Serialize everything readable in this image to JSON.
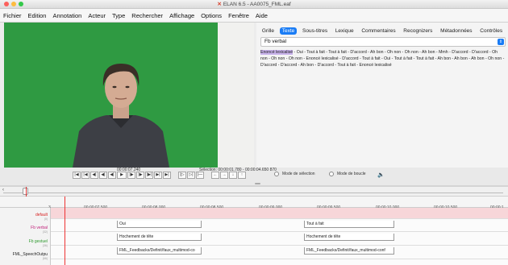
{
  "window": {
    "title": "ELAN 6.5 - AA0075_FML.eaf"
  },
  "menu": [
    "Fichier",
    "Edition",
    "Annotation",
    "Acteur",
    "Type",
    "Rechercher",
    "Affichage",
    "Options",
    "Fenêtre",
    "Aide"
  ],
  "video_controls": {
    "current_time": "00:00:07.240",
    "selection": "Sélection: 00:00:01.780 - 00:00:04.650  870",
    "buttons": [
      "|◀",
      "|◀",
      "◀|",
      "◀|",
      "◀|",
      "▶",
      "|▶",
      "|▶",
      "|▶|",
      "▶|",
      "▶|"
    ],
    "selection_buttons": [
      "|▷",
      "▷|",
      "|—"
    ],
    "nav_buttons": [
      "←",
      "→",
      "↓",
      "↑"
    ],
    "mode_selection": "Mode de sélection",
    "mode_loop": "Mode de boucle",
    "speaker_icon": "speaker-icon"
  },
  "right_panel": {
    "tabs": [
      "Grille",
      "Texte",
      "Sous-titres",
      "Lexique",
      "Commentaires",
      "Recognizers",
      "Métadonnées",
      "Contrôles"
    ],
    "active_tab": "Texte",
    "dropdown_value": "Fb verbal",
    "lexicon_highlight": "Enoncé lexicalisé",
    "lexicon_text": " - Oui - Tout à fait - Tout à fait - D'accord - Ah bon - Oh non - Oh non - Ah bon - Mmh - D'accord - D'accord - Oh non - Oh non - Oh non - Enoncé lexicalisé - D'accord - Tout à fait - Oui - Tout à fait - Tout à fait - Ah bon - Ah bon - Ah bon - Oh non - D'accord - D'accord - Ah bon - D'accord - Tout à fait - Enoncé lexicalisé"
  },
  "timeline": {
    "ticks": [
      "3",
      "00:00:07.500",
      "00:00:08.000",
      "00:00:08.500",
      "00:00:09.000",
      "00:00:09.500",
      "00:00:10.000",
      "00:00:10.500",
      "00:00:1"
    ],
    "tiers": [
      {
        "name": "default",
        "count": "(0)",
        "color": "#d62020"
      },
      {
        "name": "Fb verbal",
        "count": "(32)",
        "color": "#c0207a"
      },
      {
        "name": "Fb gestuel",
        "count": "(36)",
        "color": "#2e9a2e"
      },
      {
        "name": "FML_SpeechOutpu",
        "count": "(66)",
        "color": "#222222"
      }
    ],
    "annotations": {
      "verbal_1": "Oui",
      "verbal_2": "Tout à fait",
      "gestuel_1": "Hochement de tête",
      "gestuel_2": "Hochement de tête",
      "speech_1": "FML_Feedbacks/Definit/faux_multimod-co",
      "speech_2": "FML_Feedbacks/Definit/faux_multimod-conf"
    }
  },
  "colors": {
    "accent": "#1a7cf5",
    "green_screen": "#2f9a42",
    "default_tier_band": "#f7d6d9",
    "cursor": "#e33333"
  }
}
